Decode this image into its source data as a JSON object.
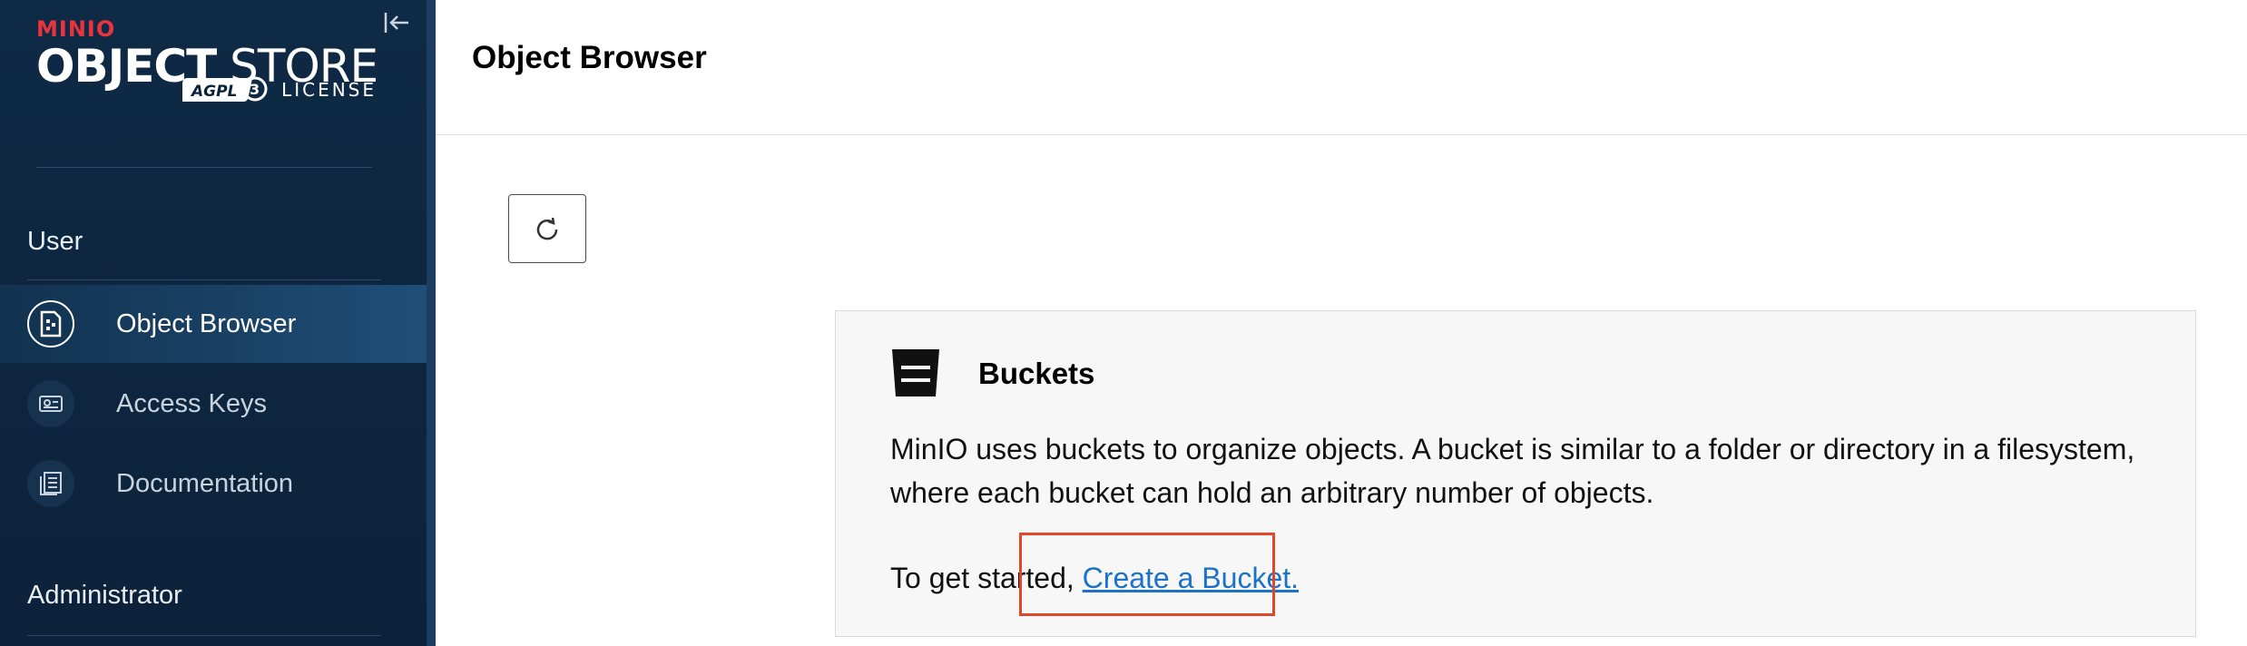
{
  "brand": {
    "vendor": "MINIO",
    "product_bold": "OBJECT",
    "product_thin": "STORE",
    "badge": "AGPLv3",
    "license": "LICENSE"
  },
  "sidebar": {
    "user_section": "User",
    "items": [
      {
        "label": "Object Browser",
        "icon": "object-browser-icon",
        "active": true
      },
      {
        "label": "Access Keys",
        "icon": "access-keys-icon",
        "active": false
      },
      {
        "label": "Documentation",
        "icon": "documentation-icon",
        "active": false
      }
    ],
    "admin_section": "Administrator"
  },
  "header": {
    "title": "Object Browser"
  },
  "toolbar": {
    "refresh_icon": "refresh-icon"
  },
  "buckets_card": {
    "title": "Buckets",
    "description": "MinIO uses buckets to organize objects. A bucket is similar to a folder or directory in a filesystem, where each bucket can hold an arbitrary number of objects.",
    "cta_prefix": "To get started, ",
    "cta_link": "Create a Bucket."
  },
  "colors": {
    "sidebar_bg": "#0f2a45",
    "active_item": "#1f4e78",
    "link": "#1b72c8",
    "highlight": "#e0472a",
    "brand_red": "#e8343e"
  }
}
